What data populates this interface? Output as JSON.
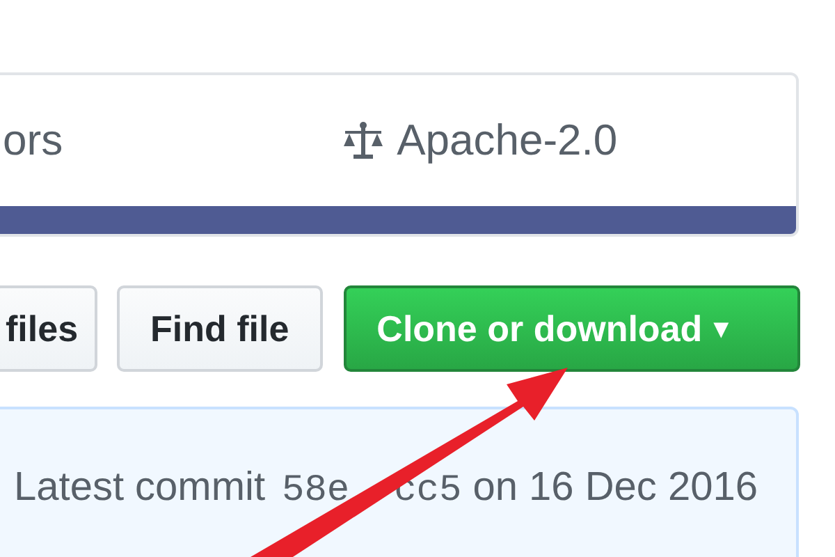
{
  "summary": {
    "items": [
      {
        "kind": "text",
        "label": "ors"
      },
      {
        "kind": "license",
        "label": "Apache-2.0"
      }
    ]
  },
  "file_buttons": [
    {
      "kind": "plain",
      "label": "files"
    },
    {
      "kind": "plain",
      "label": "Find file"
    },
    {
      "kind": "primary",
      "label": "Clone or download",
      "caret": "▾"
    }
  ],
  "commit": {
    "text": "Latest commit",
    "hash_parts": [
      "58e",
      "cc5"
    ],
    "date": "on 16 Dec 2016"
  }
}
